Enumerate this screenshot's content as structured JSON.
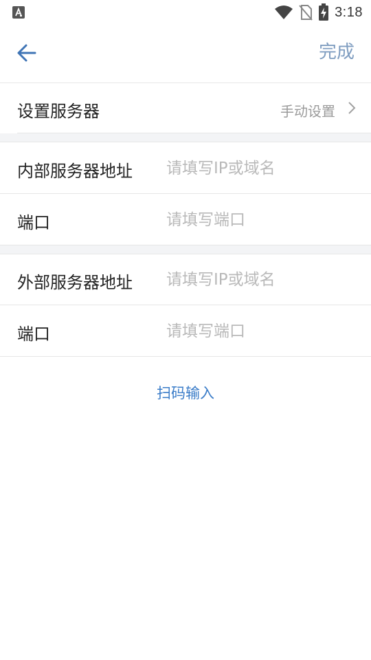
{
  "status_bar": {
    "time": "3:18",
    "icons": [
      "a-notification-icon",
      "wifi-icon",
      "no-sim-icon",
      "battery-charging-icon"
    ]
  },
  "header": {
    "back_icon": "arrow-left-icon",
    "done_label": "完成"
  },
  "server_setting": {
    "label": "设置服务器",
    "value": "手动设置",
    "chevron_icon": "chevron-right-icon"
  },
  "internal": {
    "address_label": "内部服务器地址",
    "address_placeholder": "请填写IP或域名",
    "address_value": "",
    "port_label": "端口",
    "port_placeholder": "请填写端口",
    "port_value": ""
  },
  "external": {
    "address_label": "外部服务器地址",
    "address_placeholder": "请填写IP或域名",
    "address_value": "",
    "port_label": "端口",
    "port_placeholder": "请填写端口",
    "port_value": ""
  },
  "scan_label": "扫码输入",
  "colors": {
    "accent": "#3a7cc8",
    "done": "#7f9dc0",
    "placeholder": "#b9b9b9",
    "divider": "#e6e6e6"
  }
}
